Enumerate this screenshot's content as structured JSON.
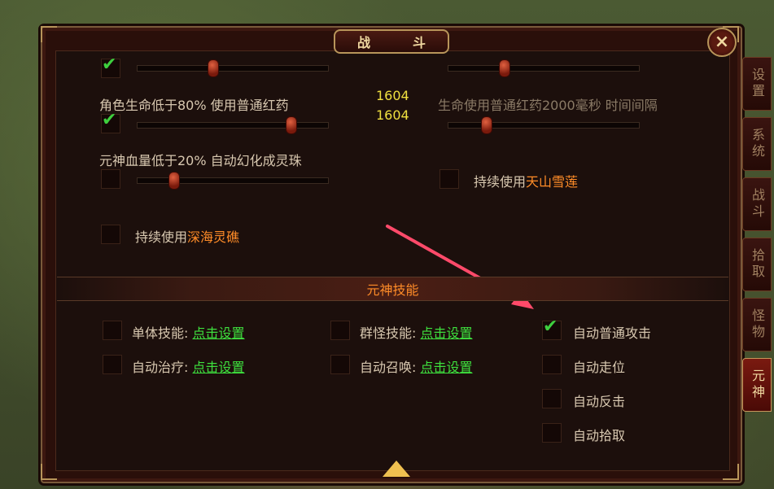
{
  "window": {
    "title": "战　斗",
    "close_label": "×"
  },
  "tabs": [
    {
      "label": "设置",
      "active": false
    },
    {
      "label": "系统",
      "active": false
    },
    {
      "label": "战斗",
      "active": false
    },
    {
      "label": "拾取",
      "active": false
    },
    {
      "label": "怪物",
      "active": false
    },
    {
      "label": "元神",
      "active": true
    }
  ],
  "settings": {
    "row1_left_checked": true,
    "role_hp_text": "角色生命低于80% 使用普通红药",
    "value_top": "1604",
    "value_bottom": "1604",
    "interval_text": "生命使用普通红药2000毫秒 时间间隔",
    "row2_left_checked": true,
    "spirit_hp_text": "元神血量低于20% 自动幻化成灵珠",
    "continuous_use_prefix": "持续使用",
    "item_snow_lotus": "天山雪莲",
    "item_sea_stone": "深海灵礁"
  },
  "section": {
    "title": "元神技能"
  },
  "skills": {
    "single_label": "单体技能:",
    "single_link": "点击设置",
    "group_label": "群怪技能:",
    "group_link": "点击设置",
    "heal_label": "自动治疗:",
    "heal_link": "点击设置",
    "summon_label": "自动召唤:",
    "summon_link": "点击设置",
    "auto_attack": "自动普通攻击",
    "auto_attack_checked": true,
    "auto_move": "自动走位",
    "auto_counter": "自动反击",
    "auto_pickup": "自动拾取"
  },
  "colors": {
    "accent": "#ff8c28",
    "link": "#3ee03e",
    "value": "#f0e040",
    "check": "#3ecf3e"
  }
}
